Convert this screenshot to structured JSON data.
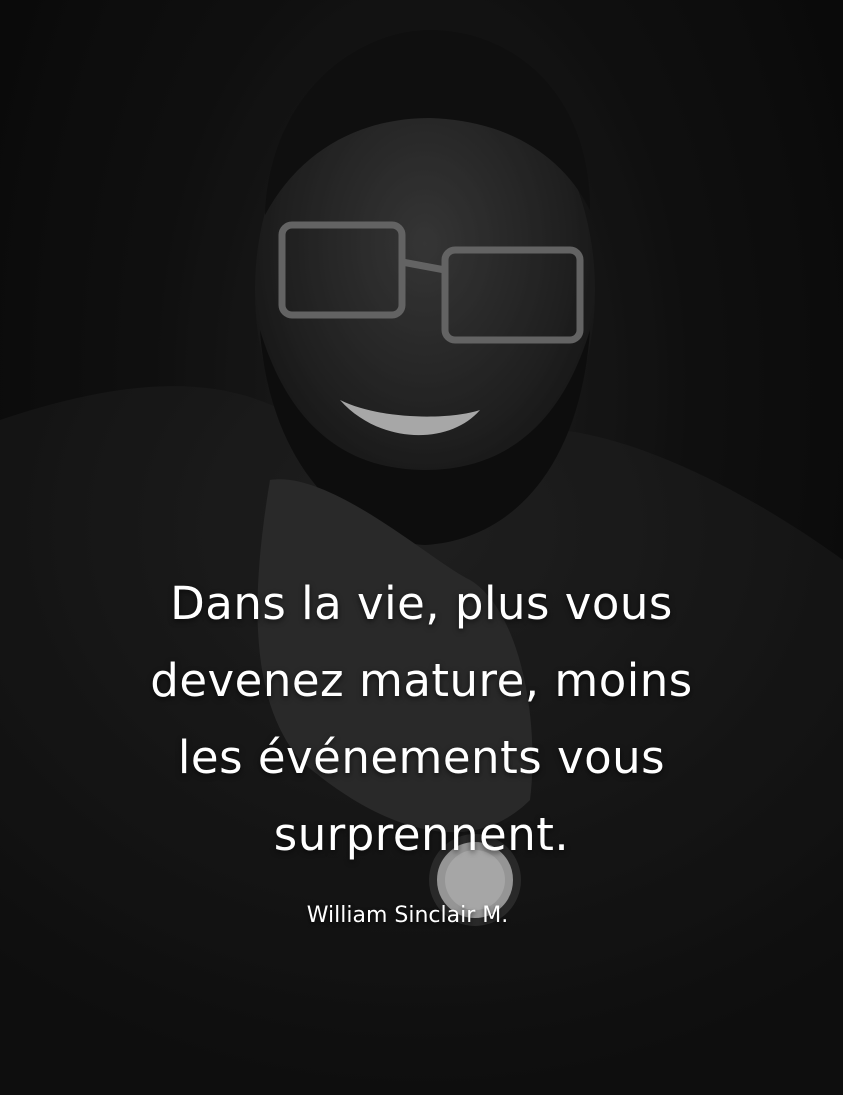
{
  "quote": {
    "lines": [
      "Dans la vie, plus vous",
      "devenez mature, moins",
      "les événements vous",
      "surprennent."
    ]
  },
  "author": "William Sinclair M.",
  "colors": {
    "background": "#0b0b0b",
    "text": "#ffffff"
  }
}
